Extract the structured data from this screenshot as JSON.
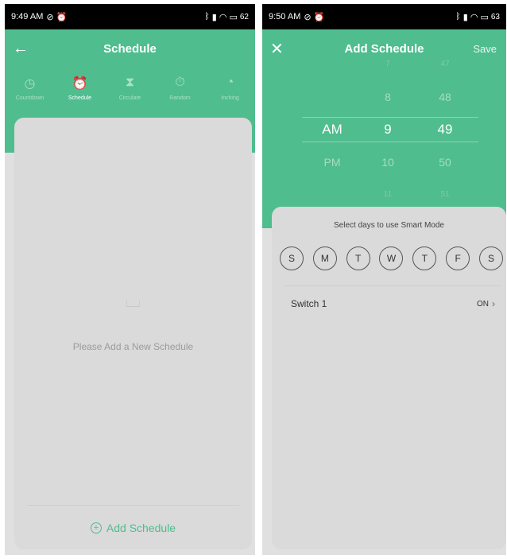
{
  "left": {
    "status": {
      "time": "9:49 AM",
      "battery": "62"
    },
    "header": {
      "title": "Schedule",
      "back_icon": "arrow-left-icon"
    },
    "modes": [
      {
        "label": "Countdown",
        "icon": "clock-icon",
        "glyph": "◷",
        "active": false
      },
      {
        "label": "Schedule",
        "icon": "alarm-clock-icon",
        "glyph": "⏰",
        "active": true
      },
      {
        "label": "Circulate",
        "icon": "hourglass-icon",
        "glyph": "⧗",
        "active": false
      },
      {
        "label": "Random",
        "icon": "stopwatch-icon",
        "glyph": "⏱",
        "active": false
      },
      {
        "label": "Inching",
        "icon": "clock-hands-icon",
        "glyph": "◔",
        "active": false
      }
    ],
    "empty": {
      "icon": "empty-inbox-icon",
      "text": "Please Add a New Schedule"
    },
    "add_button": {
      "label": "Add Schedule"
    }
  },
  "right": {
    "status": {
      "time": "9:50 AM",
      "battery": "63"
    },
    "header": {
      "title": "Add Schedule",
      "close_icon": "close-icon",
      "save_label": "Save"
    },
    "picker": {
      "ampm": [
        "AM",
        "PM"
      ],
      "hours": [
        "7",
        "8",
        "9",
        "10",
        "11"
      ],
      "minutes": [
        "47",
        "48",
        "49",
        "50",
        "51"
      ],
      "selected": {
        "ampm": "AM",
        "hour": "9",
        "minute": "49"
      }
    },
    "days_title": "Select days to use Smart Mode",
    "days": [
      "S",
      "M",
      "T",
      "W",
      "T",
      "F",
      "S"
    ],
    "switch": {
      "label": "Switch 1",
      "value": "ON"
    }
  },
  "colors": {
    "accent": "#4fbd8e",
    "background": "#e0e0e0",
    "card": "#dadada"
  }
}
